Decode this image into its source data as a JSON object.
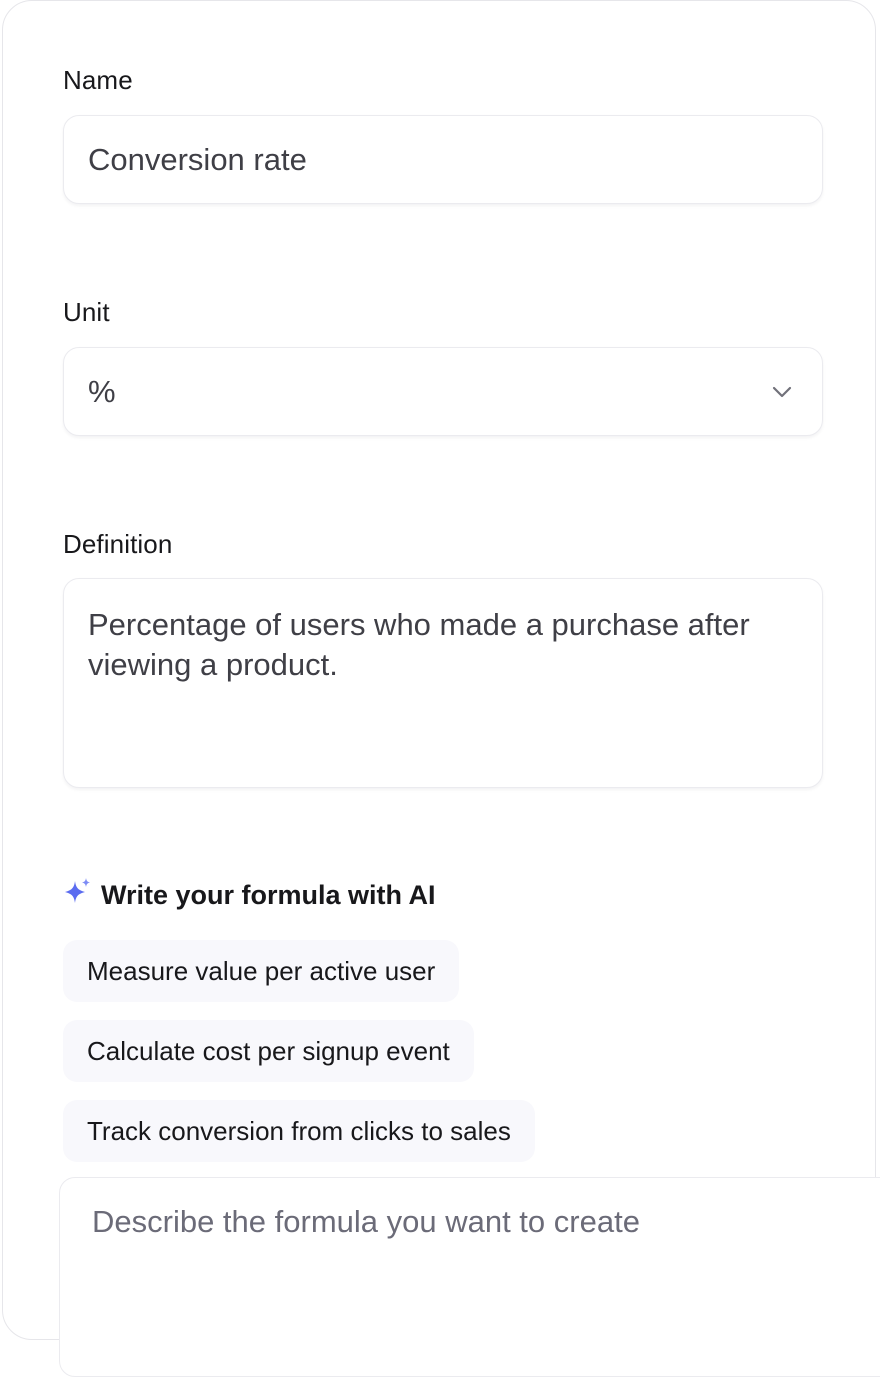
{
  "form": {
    "name_label": "Name",
    "name_value": "Conversion rate",
    "unit_label": "Unit",
    "unit_value": "%",
    "definition_label": "Definition",
    "definition_value": "Percentage of users who made a purchase after viewing a product."
  },
  "ai": {
    "heading": "Write your formula with AI",
    "suggestions": [
      "Measure value per active user",
      "Calculate cost per signup event",
      "Track conversion from clicks to sales"
    ],
    "prompt_placeholder": "Describe the formula you want to create"
  },
  "icons": {
    "sparkle": "sparkle-icon",
    "chevron": "chevron-down-icon"
  },
  "colors": {
    "accent": "#5b6cf0",
    "chip_bg": "#f8f8fc",
    "border": "#ebebef"
  }
}
